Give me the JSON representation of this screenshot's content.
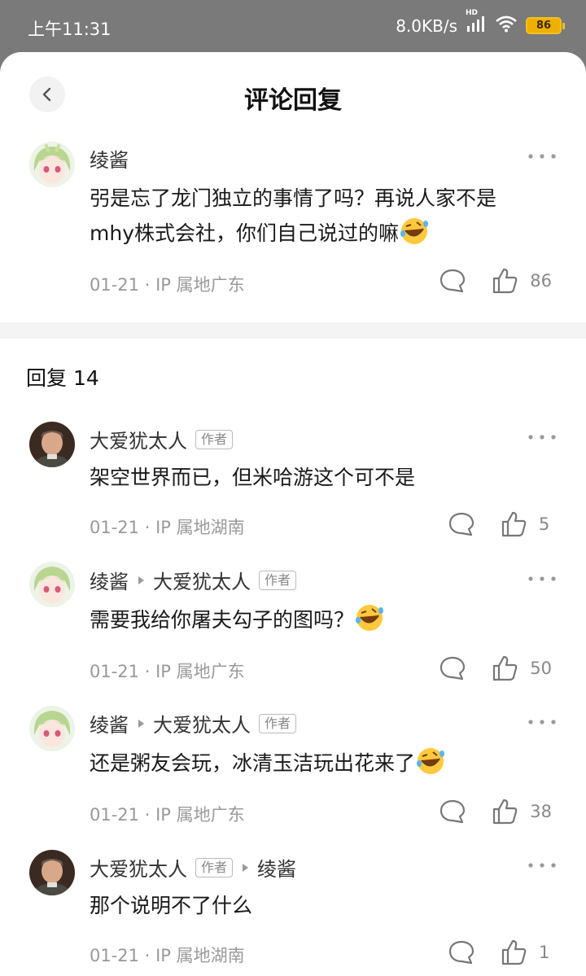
{
  "status": {
    "time": "上午11:31",
    "net_speed": "8.0KB/s",
    "network": "HD",
    "battery": "86"
  },
  "header": {
    "title": "评论回复"
  },
  "main_comment": {
    "author": "绫酱",
    "text": "弜是忘了龙门独立的事情了吗？再说人家不是mhy株式会社，你们自己说过的嘛",
    "emoji": "rofl-emoji",
    "date": "01-21",
    "ip": "IP 属地广东",
    "likes": "86"
  },
  "replies_header": "回复 14",
  "replies": [
    {
      "author": "大爱犹太人",
      "author_tag": "作者",
      "text": "架空世界而已，但米哈游这个可不是",
      "date": "01-21",
      "ip": "IP 属地湖南",
      "likes": "5"
    },
    {
      "author": "绫酱",
      "reply_to": "大爱犹太人",
      "reply_to_tag": "作者",
      "text": "需要我给你屠夫勾子的图吗？",
      "emoji": "rofl-emoji",
      "date": "01-21",
      "ip": "IP 属地广东",
      "likes": "50"
    },
    {
      "author": "绫酱",
      "reply_to": "大爱犹太人",
      "reply_to_tag": "作者",
      "text": "还是粥友会玩，冰清玉洁玩出花来了",
      "emoji": "rofl-emoji",
      "date": "01-21",
      "ip": "IP 属地广东",
      "likes": "38"
    },
    {
      "author": "大爱犹太人",
      "author_tag": "作者",
      "reply_to": "绫酱",
      "text": "那个说明不了什么",
      "date": "01-21",
      "ip": "IP 属地湖南",
      "likes": "1"
    }
  ],
  "separator": "·",
  "colors": {
    "meta": "#999999",
    "tag_border": "#bbbbbb",
    "battery": "#f0b000"
  }
}
